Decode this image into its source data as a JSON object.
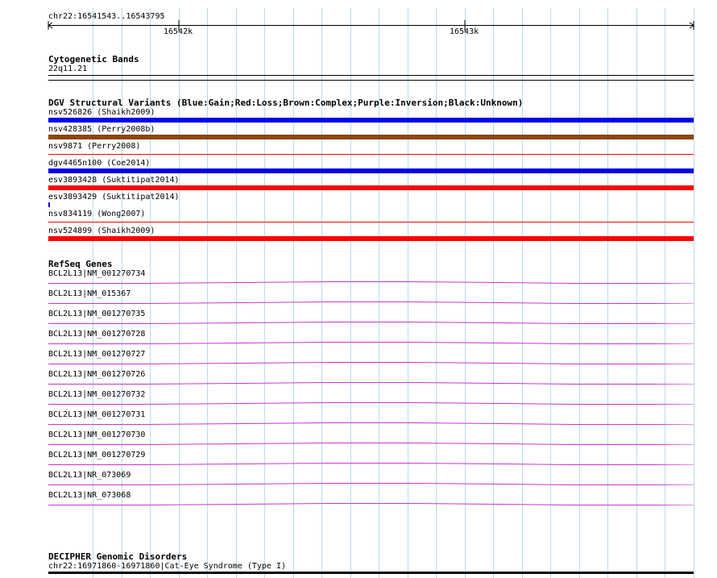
{
  "header": {
    "coordinates": "chr22:16541543..16543795",
    "ticks": [
      {
        "label": "16542k"
      },
      {
        "label": "16543k"
      }
    ]
  },
  "cytogenetic": {
    "title": "Cytogenetic Bands",
    "band": "22q11.21"
  },
  "dgv": {
    "title": "DGV Structural Variants (Blue:Gain;Red:Loss;Brown:Complex;Purple:Inversion;Black:Unknown)",
    "colors": {
      "gain": "#0000e6",
      "loss": "#ff0000",
      "complex": "#8b4513"
    },
    "variants": [
      {
        "label": "nsv526826 (Shaikh2009)",
        "type": "gain",
        "style": "thick"
      },
      {
        "label": "nsv428385 (Perry2008b)",
        "type": "complex",
        "style": "thick"
      },
      {
        "label": "nsv9871 (Perry2008)",
        "type": "loss",
        "style": "thin"
      },
      {
        "label": "dgv4465n100 (Coe2014)",
        "type": "gain",
        "style": "thick"
      },
      {
        "label": "esv3893428 (Suktitipat2014)",
        "type": "loss",
        "style": "thick"
      },
      {
        "label": "esv3893429 (Suktitipat2014)",
        "type": "gain",
        "style": "tiny"
      },
      {
        "label": "nsv834119 (Wong2007)",
        "type": "loss",
        "style": "thin"
      },
      {
        "label": "nsv524899 (Shaikh2009)",
        "type": "loss",
        "style": "thick"
      }
    ]
  },
  "refseq": {
    "title": "RefSeq Genes",
    "color": "#cc33cc",
    "genes": [
      {
        "label": "BCL2L13|NM_001270734"
      },
      {
        "label": "BCL2L13|NM_015367"
      },
      {
        "label": "BCL2L13|NM_001270735"
      },
      {
        "label": "BCL2L13|NM_001270728"
      },
      {
        "label": "BCL2L13|NM_001270727"
      },
      {
        "label": "BCL2L13|NM_001270726"
      },
      {
        "label": "BCL2L13|NM_001270732"
      },
      {
        "label": "BCL2L13|NM_001270731"
      },
      {
        "label": "BCL2L13|NM_001270730"
      },
      {
        "label": "BCL2L13|NM_001270729"
      },
      {
        "label": "BCL2L13|NR_073069"
      },
      {
        "label": "BCL2L13|NR_073068"
      }
    ]
  },
  "decipher": {
    "title": "DECIPHER Genomic Disorders",
    "entry": "chr22:16971860-16971860|Cat-Eye Syndrome (Type I)"
  }
}
